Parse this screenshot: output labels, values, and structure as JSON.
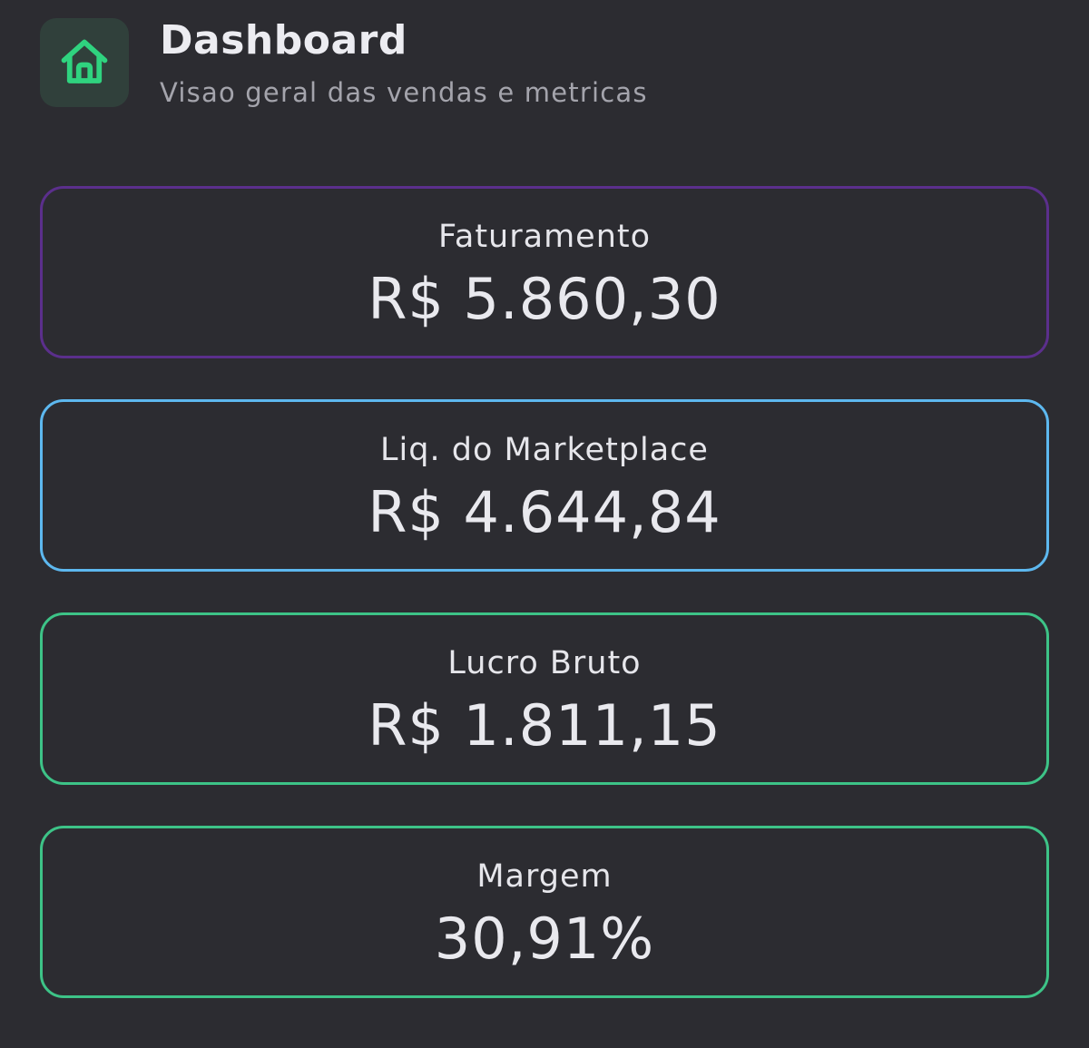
{
  "header": {
    "icon": "home-icon",
    "title": "Dashboard",
    "subtitle": "Visao geral das vendas e metricas"
  },
  "colors": {
    "background": "#2c2c31",
    "home_icon": "#2fd37f",
    "faturamento_border": "#5b2f8c",
    "liquido_border": "#5db8ef",
    "lucro_border": "#3dc387",
    "margem_border": "#3dc387"
  },
  "metrics": [
    {
      "label": "Faturamento",
      "value": "R$ 5.860,30"
    },
    {
      "label": "Liq. do Marketplace",
      "value": "R$ 4.644,84"
    },
    {
      "label": "Lucro Bruto",
      "value": "R$ 1.811,15"
    },
    {
      "label": "Margem",
      "value": "30,91%"
    }
  ]
}
